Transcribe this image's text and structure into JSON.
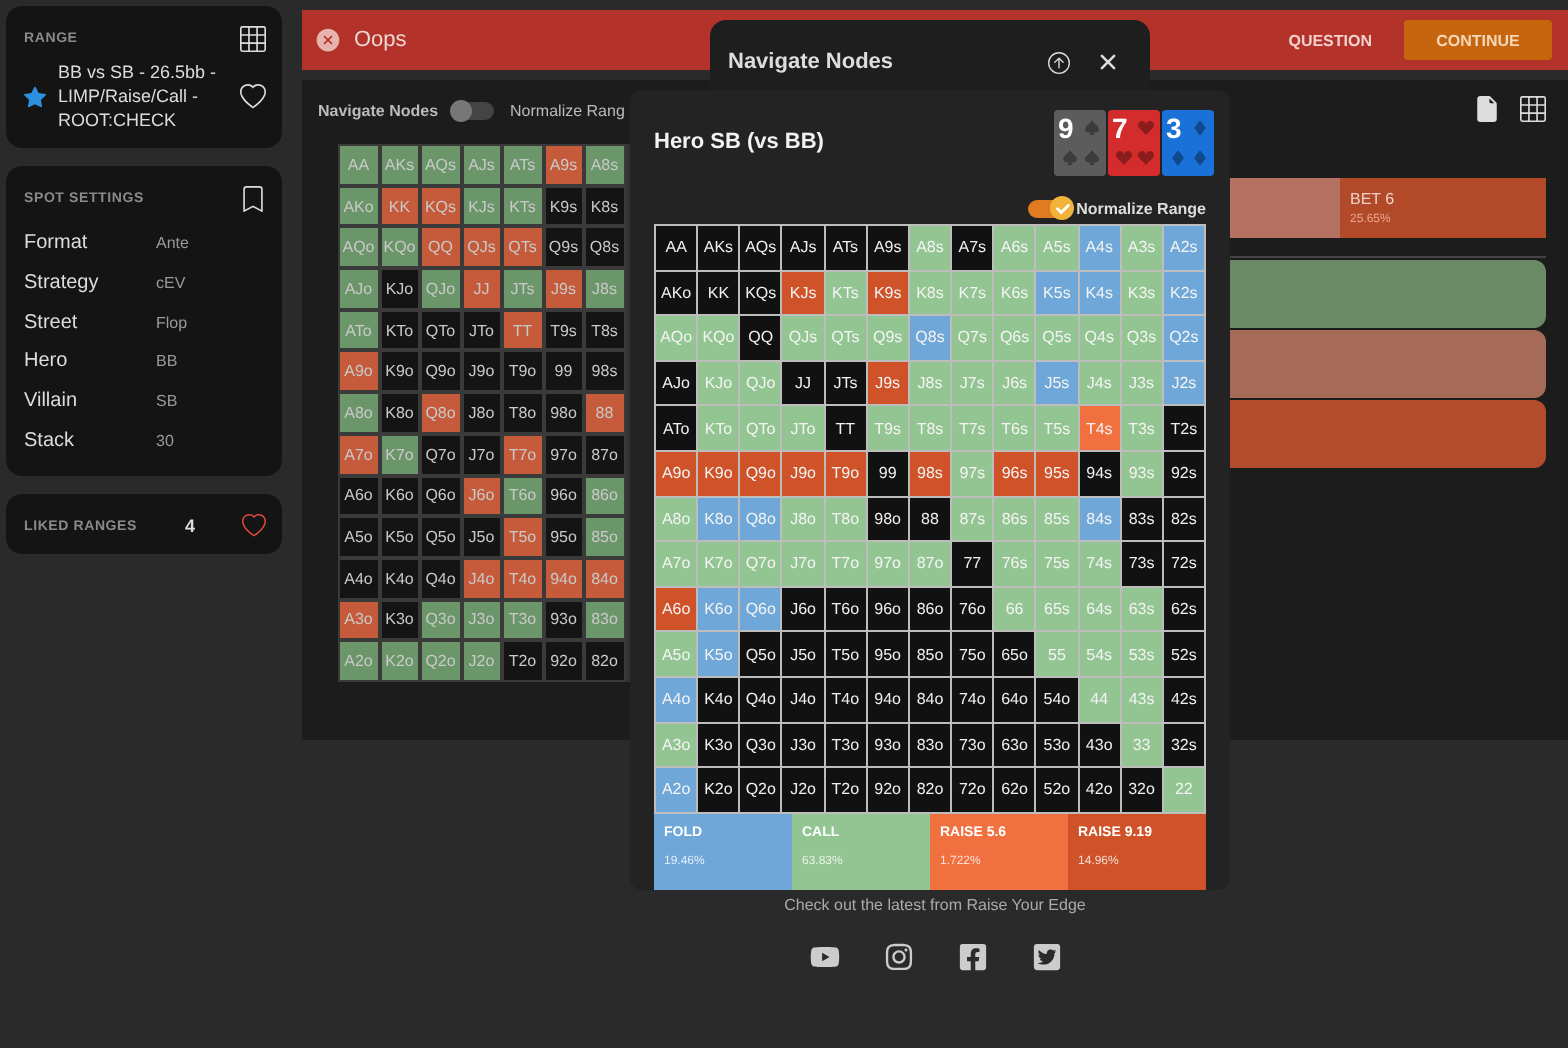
{
  "sidebar": {
    "range": {
      "heading": "RANGE",
      "title": "BB vs SB - 26.5bb - LIMP/Raise/Call - ROOT:CHECK",
      "starred": true
    },
    "spot_settings": {
      "heading": "SPOT SETTINGS",
      "rows": [
        {
          "label": "Format",
          "value": "Ante"
        },
        {
          "label": "Strategy",
          "value": "cEV"
        },
        {
          "label": "Street",
          "value": "Flop"
        },
        {
          "label": "Hero",
          "value": "BB"
        },
        {
          "label": "Villain",
          "value": "SB"
        },
        {
          "label": "Stack",
          "value": "30"
        }
      ]
    },
    "liked_ranges": {
      "label": "LIKED RANGES",
      "count": "4"
    }
  },
  "top_bar": {
    "title": "Oops",
    "question": "QUESTION",
    "continue": "CONTINUE"
  },
  "background": {
    "heading": "Navigate Nodes",
    "normalize": {
      "label": "Normalize Rang",
      "on": false
    },
    "grid": [
      [
        {
          "label": "AA",
          "kind": "call"
        },
        {
          "label": "AKs",
          "kind": "call"
        },
        {
          "label": "AQs",
          "kind": "call"
        },
        {
          "label": "AJs",
          "kind": "call"
        },
        {
          "label": "ATs",
          "kind": "call"
        },
        {
          "label": "A9s",
          "kind": "raise"
        },
        {
          "label": "A8s",
          "kind": "call"
        }
      ],
      [
        {
          "label": "AKo",
          "kind": "call"
        },
        {
          "label": "KK",
          "kind": "raise"
        },
        {
          "label": "KQs",
          "kind": "raise"
        },
        {
          "label": "KJs",
          "kind": "call"
        },
        {
          "label": "KTs",
          "kind": "call"
        },
        {
          "label": "K9s",
          "kind": "fold"
        },
        {
          "label": "K8s",
          "kind": "fold"
        }
      ],
      [
        {
          "label": "AQo",
          "kind": "call"
        },
        {
          "label": "KQo",
          "kind": "call"
        },
        {
          "label": "QQ",
          "kind": "raise"
        },
        {
          "label": "QJs",
          "kind": "raise"
        },
        {
          "label": "QTs",
          "kind": "raise"
        },
        {
          "label": "Q9s",
          "kind": "fold"
        },
        {
          "label": "Q8s",
          "kind": "fold"
        }
      ],
      [
        {
          "label": "AJo",
          "kind": "call"
        },
        {
          "label": "KJo",
          "kind": "fold"
        },
        {
          "label": "QJo",
          "kind": "call"
        },
        {
          "label": "JJ",
          "kind": "raise"
        },
        {
          "label": "JTs",
          "kind": "call"
        },
        {
          "label": "J9s",
          "kind": "raise"
        },
        {
          "label": "J8s",
          "kind": "call"
        }
      ],
      [
        {
          "label": "ATo",
          "kind": "call"
        },
        {
          "label": "KTo",
          "kind": "fold"
        },
        {
          "label": "QTo",
          "kind": "fold"
        },
        {
          "label": "JTo",
          "kind": "fold"
        },
        {
          "label": "TT",
          "kind": "raise"
        },
        {
          "label": "T9s",
          "kind": "fold"
        },
        {
          "label": "T8s",
          "kind": "fold"
        }
      ],
      [
        {
          "label": "A9o",
          "kind": "raise"
        },
        {
          "label": "K9o",
          "kind": "fold"
        },
        {
          "label": "Q9o",
          "kind": "fold"
        },
        {
          "label": "J9o",
          "kind": "fold"
        },
        {
          "label": "T9o",
          "kind": "fold"
        },
        {
          "label": "99",
          "kind": "fold"
        },
        {
          "label": "98s",
          "kind": "fold"
        }
      ],
      [
        {
          "label": "A8o",
          "kind": "call"
        },
        {
          "label": "K8o",
          "kind": "fold"
        },
        {
          "label": "Q8o",
          "kind": "raise"
        },
        {
          "label": "J8o",
          "kind": "fold"
        },
        {
          "label": "T8o",
          "kind": "fold"
        },
        {
          "label": "98o",
          "kind": "fold"
        },
        {
          "label": "88",
          "kind": "raise"
        }
      ],
      [
        {
          "label": "A7o",
          "kind": "raise"
        },
        {
          "label": "K7o",
          "kind": "call"
        },
        {
          "label": "Q7o",
          "kind": "fold"
        },
        {
          "label": "J7o",
          "kind": "fold"
        },
        {
          "label": "T7o",
          "kind": "raise"
        },
        {
          "label": "97o",
          "kind": "fold"
        },
        {
          "label": "87o",
          "kind": "fold"
        }
      ],
      [
        {
          "label": "A6o",
          "kind": "fold"
        },
        {
          "label": "K6o",
          "kind": "fold"
        },
        {
          "label": "Q6o",
          "kind": "fold"
        },
        {
          "label": "J6o",
          "kind": "raise"
        },
        {
          "label": "T6o",
          "kind": "call"
        },
        {
          "label": "96o",
          "kind": "fold"
        },
        {
          "label": "86o",
          "kind": "call"
        }
      ],
      [
        {
          "label": "A5o",
          "kind": "fold"
        },
        {
          "label": "K5o",
          "kind": "fold"
        },
        {
          "label": "Q5o",
          "kind": "fold"
        },
        {
          "label": "J5o",
          "kind": "fold"
        },
        {
          "label": "T5o",
          "kind": "raise"
        },
        {
          "label": "95o",
          "kind": "fold"
        },
        {
          "label": "85o",
          "kind": "call"
        }
      ],
      [
        {
          "label": "A4o",
          "kind": "fold"
        },
        {
          "label": "K4o",
          "kind": "fold"
        },
        {
          "label": "Q4o",
          "kind": "fold"
        },
        {
          "label": "J4o",
          "kind": "raise"
        },
        {
          "label": "T4o",
          "kind": "raise"
        },
        {
          "label": "94o",
          "kind": "raise"
        },
        {
          "label": "84o",
          "kind": "raise"
        }
      ],
      [
        {
          "label": "A3o",
          "kind": "raise"
        },
        {
          "label": "K3o",
          "kind": "fold"
        },
        {
          "label": "Q3o",
          "kind": "call"
        },
        {
          "label": "J3o",
          "kind": "call"
        },
        {
          "label": "T3o",
          "kind": "call"
        },
        {
          "label": "93o",
          "kind": "fold"
        },
        {
          "label": "83o",
          "kind": "call"
        }
      ],
      [
        {
          "label": "A2o",
          "kind": "call"
        },
        {
          "label": "K2o",
          "kind": "call"
        },
        {
          "label": "Q2o",
          "kind": "call"
        },
        {
          "label": "J2o",
          "kind": "call"
        },
        {
          "label": "T2o",
          "kind": "fold"
        },
        {
          "label": "92o",
          "kind": "fold"
        },
        {
          "label": "82o",
          "kind": "fold"
        }
      ]
    ],
    "bet_bar": {
      "label": "BET 6",
      "share": "25.65%"
    },
    "action_bars": [
      {
        "kind": "call"
      },
      {
        "kind": "mixed"
      },
      {
        "kind": "raise"
      }
    ]
  },
  "navigate_tab": {
    "title": "Navigate Nodes"
  },
  "modal": {
    "title": "Hero SB (vs BB)",
    "board": [
      {
        "rank": "9",
        "kind": "spade"
      },
      {
        "rank": "7",
        "kind": "heart"
      },
      {
        "rank": "3",
        "kind": "diamond"
      }
    ],
    "normalize": {
      "label": "Normalize Range",
      "on": true
    },
    "grid": [
      [
        {
          "label": "AA",
          "kind": "empty"
        },
        {
          "label": "AKs",
          "kind": "empty"
        },
        {
          "label": "AQs",
          "kind": "empty"
        },
        {
          "label": "AJs",
          "kind": "empty"
        },
        {
          "label": "ATs",
          "kind": "empty"
        },
        {
          "label": "A9s",
          "kind": "empty"
        },
        {
          "label": "A8s",
          "kind": "call"
        },
        {
          "label": "A7s",
          "kind": "empty"
        },
        {
          "label": "A6s",
          "kind": "call"
        },
        {
          "label": "A5s",
          "kind": "call"
        },
        {
          "label": "A4s",
          "kind": "fold"
        },
        {
          "label": "A3s",
          "kind": "call"
        },
        {
          "label": "A2s",
          "kind": "fold"
        }
      ],
      [
        {
          "label": "AKo",
          "kind": "empty"
        },
        {
          "label": "KK",
          "kind": "empty"
        },
        {
          "label": "KQs",
          "kind": "empty"
        },
        {
          "label": "KJs",
          "kind": "large"
        },
        {
          "label": "KTs",
          "kind": "call"
        },
        {
          "label": "K9s",
          "kind": "large"
        },
        {
          "label": "K8s",
          "kind": "call"
        },
        {
          "label": "K7s",
          "kind": "call"
        },
        {
          "label": "K6s",
          "kind": "call"
        },
        {
          "label": "K5s",
          "kind": "fold"
        },
        {
          "label": "K4s",
          "kind": "fold"
        },
        {
          "label": "K3s",
          "kind": "call"
        },
        {
          "label": "K2s",
          "kind": "fold"
        }
      ],
      [
        {
          "label": "AQo",
          "kind": "call"
        },
        {
          "label": "KQo",
          "kind": "call"
        },
        {
          "label": "QQ",
          "kind": "empty"
        },
        {
          "label": "QJs",
          "kind": "call"
        },
        {
          "label": "QTs",
          "kind": "call"
        },
        {
          "label": "Q9s",
          "kind": "call"
        },
        {
          "label": "Q8s",
          "kind": "fold"
        },
        {
          "label": "Q7s",
          "kind": "call"
        },
        {
          "label": "Q6s",
          "kind": "call"
        },
        {
          "label": "Q5s",
          "kind": "call"
        },
        {
          "label": "Q4s",
          "kind": "call"
        },
        {
          "label": "Q3s",
          "kind": "call"
        },
        {
          "label": "Q2s",
          "kind": "fold"
        }
      ],
      [
        {
          "label": "AJo",
          "kind": "empty"
        },
        {
          "label": "KJo",
          "kind": "call"
        },
        {
          "label": "QJo",
          "kind": "call"
        },
        {
          "label": "JJ",
          "kind": "empty"
        },
        {
          "label": "JTs",
          "kind": "empty"
        },
        {
          "label": "J9s",
          "kind": "large"
        },
        {
          "label": "J8s",
          "kind": "call"
        },
        {
          "label": "J7s",
          "kind": "call"
        },
        {
          "label": "J6s",
          "kind": "call"
        },
        {
          "label": "J5s",
          "kind": "fold"
        },
        {
          "label": "J4s",
          "kind": "call"
        },
        {
          "label": "J3s",
          "kind": "call"
        },
        {
          "label": "J2s",
          "kind": "fold"
        }
      ],
      [
        {
          "label": "ATo",
          "kind": "empty"
        },
        {
          "label": "KTo",
          "kind": "call"
        },
        {
          "label": "QTo",
          "kind": "call"
        },
        {
          "label": "JTo",
          "kind": "call"
        },
        {
          "label": "TT",
          "kind": "empty"
        },
        {
          "label": "T9s",
          "kind": "call"
        },
        {
          "label": "T8s",
          "kind": "call"
        },
        {
          "label": "T7s",
          "kind": "call"
        },
        {
          "label": "T6s",
          "kind": "call"
        },
        {
          "label": "T5s",
          "kind": "call"
        },
        {
          "label": "T4s",
          "kind": "small"
        },
        {
          "label": "T3s",
          "kind": "call"
        },
        {
          "label": "T2s",
          "kind": "empty"
        }
      ],
      [
        {
          "label": "A9o",
          "kind": "large"
        },
        {
          "label": "K9o",
          "kind": "large"
        },
        {
          "label": "Q9o",
          "kind": "large"
        },
        {
          "label": "J9o",
          "kind": "large"
        },
        {
          "label": "T9o",
          "kind": "large"
        },
        {
          "label": "99",
          "kind": "empty"
        },
        {
          "label": "98s",
          "kind": "large"
        },
        {
          "label": "97s",
          "kind": "call"
        },
        {
          "label": "96s",
          "kind": "large"
        },
        {
          "label": "95s",
          "kind": "large"
        },
        {
          "label": "94s",
          "kind": "empty"
        },
        {
          "label": "93s",
          "kind": "call"
        },
        {
          "label": "92s",
          "kind": "empty"
        }
      ],
      [
        {
          "label": "A8o",
          "kind": "call"
        },
        {
          "label": "K8o",
          "kind": "fold"
        },
        {
          "label": "Q8o",
          "kind": "fold"
        },
        {
          "label": "J8o",
          "kind": "call"
        },
        {
          "label": "T8o",
          "kind": "call"
        },
        {
          "label": "98o",
          "kind": "empty"
        },
        {
          "label": "88",
          "kind": "empty"
        },
        {
          "label": "87s",
          "kind": "call"
        },
        {
          "label": "86s",
          "kind": "call"
        },
        {
          "label": "85s",
          "kind": "call"
        },
        {
          "label": "84s",
          "kind": "fold"
        },
        {
          "label": "83s",
          "kind": "empty"
        },
        {
          "label": "82s",
          "kind": "empty"
        }
      ],
      [
        {
          "label": "A7o",
          "kind": "call"
        },
        {
          "label": "K7o",
          "kind": "call"
        },
        {
          "label": "Q7o",
          "kind": "call"
        },
        {
          "label": "J7o",
          "kind": "call"
        },
        {
          "label": "T7o",
          "kind": "call"
        },
        {
          "label": "97o",
          "kind": "call"
        },
        {
          "label": "87o",
          "kind": "call"
        },
        {
          "label": "77",
          "kind": "empty"
        },
        {
          "label": "76s",
          "kind": "call"
        },
        {
          "label": "75s",
          "kind": "call"
        },
        {
          "label": "74s",
          "kind": "call"
        },
        {
          "label": "73s",
          "kind": "empty"
        },
        {
          "label": "72s",
          "kind": "empty"
        }
      ],
      [
        {
          "label": "A6o",
          "kind": "large"
        },
        {
          "label": "K6o",
          "kind": "fold"
        },
        {
          "label": "Q6o",
          "kind": "fold"
        },
        {
          "label": "J6o",
          "kind": "empty"
        },
        {
          "label": "T6o",
          "kind": "empty"
        },
        {
          "label": "96o",
          "kind": "empty"
        },
        {
          "label": "86o",
          "kind": "empty"
        },
        {
          "label": "76o",
          "kind": "empty"
        },
        {
          "label": "66",
          "kind": "call"
        },
        {
          "label": "65s",
          "kind": "call"
        },
        {
          "label": "64s",
          "kind": "call"
        },
        {
          "label": "63s",
          "kind": "call"
        },
        {
          "label": "62s",
          "kind": "empty"
        }
      ],
      [
        {
          "label": "A5o",
          "kind": "call"
        },
        {
          "label": "K5o",
          "kind": "fold"
        },
        {
          "label": "Q5o",
          "kind": "empty"
        },
        {
          "label": "J5o",
          "kind": "empty"
        },
        {
          "label": "T5o",
          "kind": "empty"
        },
        {
          "label": "95o",
          "kind": "empty"
        },
        {
          "label": "85o",
          "kind": "empty"
        },
        {
          "label": "75o",
          "kind": "empty"
        },
        {
          "label": "65o",
          "kind": "empty"
        },
        {
          "label": "55",
          "kind": "call"
        },
        {
          "label": "54s",
          "kind": "call"
        },
        {
          "label": "53s",
          "kind": "call"
        },
        {
          "label": "52s",
          "kind": "empty"
        }
      ],
      [
        {
          "label": "A4o",
          "kind": "fold"
        },
        {
          "label": "K4o",
          "kind": "empty"
        },
        {
          "label": "Q4o",
          "kind": "empty"
        },
        {
          "label": "J4o",
          "kind": "empty"
        },
        {
          "label": "T4o",
          "kind": "empty"
        },
        {
          "label": "94o",
          "kind": "empty"
        },
        {
          "label": "84o",
          "kind": "empty"
        },
        {
          "label": "74o",
          "kind": "empty"
        },
        {
          "label": "64o",
          "kind": "empty"
        },
        {
          "label": "54o",
          "kind": "empty"
        },
        {
          "label": "44",
          "kind": "call"
        },
        {
          "label": "43s",
          "kind": "call"
        },
        {
          "label": "42s",
          "kind": "empty"
        }
      ],
      [
        {
          "label": "A3o",
          "kind": "call"
        },
        {
          "label": "K3o",
          "kind": "empty"
        },
        {
          "label": "Q3o",
          "kind": "empty"
        },
        {
          "label": "J3o",
          "kind": "empty"
        },
        {
          "label": "T3o",
          "kind": "empty"
        },
        {
          "label": "93o",
          "kind": "empty"
        },
        {
          "label": "83o",
          "kind": "empty"
        },
        {
          "label": "73o",
          "kind": "empty"
        },
        {
          "label": "63o",
          "kind": "empty"
        },
        {
          "label": "53o",
          "kind": "empty"
        },
        {
          "label": "43o",
          "kind": "empty"
        },
        {
          "label": "33",
          "kind": "call"
        },
        {
          "label": "32s",
          "kind": "empty"
        }
      ],
      [
        {
          "label": "A2o",
          "kind": "fold"
        },
        {
          "label": "K2o",
          "kind": "empty"
        },
        {
          "label": "Q2o",
          "kind": "empty"
        },
        {
          "label": "J2o",
          "kind": "empty"
        },
        {
          "label": "T2o",
          "kind": "empty"
        },
        {
          "label": "92o",
          "kind": "empty"
        },
        {
          "label": "82o",
          "kind": "empty"
        },
        {
          "label": "72o",
          "kind": "empty"
        },
        {
          "label": "62o",
          "kind": "empty"
        },
        {
          "label": "52o",
          "kind": "empty"
        },
        {
          "label": "42o",
          "kind": "empty"
        },
        {
          "label": "32o",
          "kind": "empty"
        },
        {
          "label": "22",
          "kind": "call"
        }
      ]
    ],
    "legend": [
      {
        "kind": "fold",
        "label": "FOLD",
        "share": "19.46%"
      },
      {
        "kind": "call",
        "label": "CALL",
        "share": "63.83%"
      },
      {
        "kind": "small",
        "label": "RAISE 5.6",
        "share": "1.722%"
      },
      {
        "kind": "large",
        "label": "RAISE 9.19",
        "share": "14.96%"
      }
    ]
  },
  "footer": {
    "text": "Check out the latest from Raise Your Edge"
  }
}
